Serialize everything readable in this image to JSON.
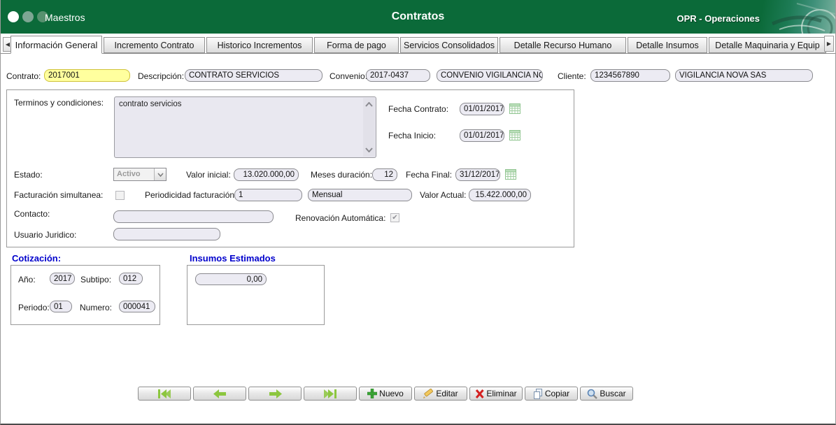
{
  "header": {
    "app_title": "Maestros",
    "page_title": "Contratos",
    "right_label": "OPR - Operaciones"
  },
  "tabs": {
    "items": [
      {
        "label": "Información General",
        "active": true
      },
      {
        "label": "Incremento Contrato",
        "active": false
      },
      {
        "label": "Historico Incrementos",
        "active": false
      },
      {
        "label": "Forma de pago",
        "active": false
      },
      {
        "label": "Servicios Consolidados",
        "active": false
      },
      {
        "label": "Detalle Recurso Humano",
        "active": false
      },
      {
        "label": "Detalle Insumos",
        "active": false
      },
      {
        "label": "Detalle Maquinaria y Equip",
        "active": false
      }
    ],
    "scroll_left_icon": "◀",
    "scroll_right_icon": "▶"
  },
  "row1": {
    "contrato": {
      "label": "Contrato:",
      "value": "2017001"
    },
    "descripcion": {
      "label": "Descripción:",
      "value": "CONTRATO SERVICIOS"
    },
    "convenio": {
      "label": "Convenio:",
      "code": "2017-0437",
      "name": "CONVENIO  VIGILANCIA NOV"
    },
    "cliente": {
      "label": "Cliente:",
      "id": "1234567890",
      "name": "VIGILANCIA NOVA SAS"
    }
  },
  "general": {
    "terminos": {
      "label": "Terminos y condiciones:",
      "value": "contrato servicios"
    },
    "fecha_contrato": {
      "label": "Fecha Contrato:",
      "value": "01/01/2017"
    },
    "fecha_inicio": {
      "label": "Fecha Inicio:",
      "value": "01/01/2017"
    },
    "estado": {
      "label": "Estado:",
      "value": "Activo"
    },
    "valor_inicial": {
      "label": "Valor inicial:",
      "value": "13.020.000,00"
    },
    "meses_duracion": {
      "label": "Meses duración:",
      "value": "12"
    },
    "fecha_final": {
      "label": "Fecha Final:",
      "value": "31/12/2017"
    },
    "facturacion_simultanea": {
      "label": "Facturación simultanea:",
      "checked": false
    },
    "periodicidad": {
      "label": "Periodicidad facturación:",
      "value": "1",
      "desc": "Mensual"
    },
    "valor_actual": {
      "label": "Valor Actual:",
      "value": "15.422.000,00"
    },
    "contacto": {
      "label": "Contacto:",
      "value": ""
    },
    "renovacion_automatica": {
      "label": "Renovación Automática:",
      "checked": true,
      "check_glyph": "✔"
    },
    "usuario_juridico": {
      "label": "Usuario Juridico:",
      "value": ""
    }
  },
  "cotizacion": {
    "title": "Cotización:",
    "ano": {
      "label": "Año:",
      "value": "2017"
    },
    "subtipo": {
      "label": "Subtipo:",
      "value": "012"
    },
    "periodo": {
      "label": "Periodo:",
      "value": "01"
    },
    "numero": {
      "label": "Numero:",
      "value": "000041"
    }
  },
  "insumos": {
    "title": "Insumos Estimados",
    "value": "0,00"
  },
  "toolbar": {
    "nuevo": "Nuevo",
    "editar": "Editar",
    "eliminar": "Eliminar",
    "copiar": "Copiar",
    "buscar": "Buscar"
  },
  "colors": {
    "header_green": "#0b6a39",
    "accent_blue": "#0000cc",
    "nav_arrow_green": "#8cc63f",
    "highlight_yellow": "#ffff9e",
    "delete_red": "#d42020"
  }
}
